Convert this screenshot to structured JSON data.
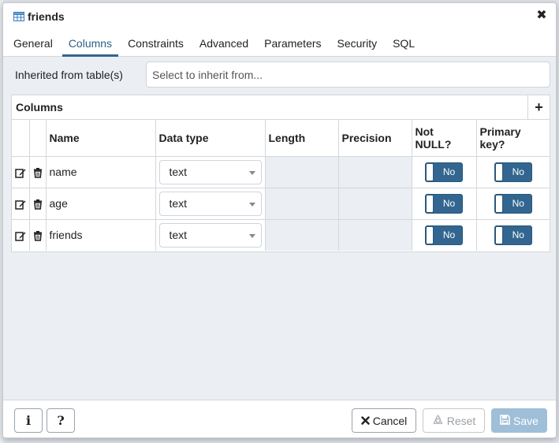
{
  "dialog": {
    "title": "friends",
    "close_glyph": "✖"
  },
  "tabs": [
    {
      "label": "General",
      "active": false
    },
    {
      "label": "Columns",
      "active": true
    },
    {
      "label": "Constraints",
      "active": false
    },
    {
      "label": "Advanced",
      "active": false
    },
    {
      "label": "Parameters",
      "active": false
    },
    {
      "label": "Security",
      "active": false
    },
    {
      "label": "SQL",
      "active": false
    }
  ],
  "inherit": {
    "label": "Inherited from table(s)",
    "placeholder": "Select to inherit from..."
  },
  "columns_panel": {
    "title": "Columns",
    "add_glyph": "+",
    "headers": [
      "Name",
      "Data type",
      "Length",
      "Precision",
      "Not NULL?",
      "Primary key?"
    ],
    "rows": [
      {
        "name": "name",
        "data_type": "text",
        "not_null": "No",
        "primary_key": "No"
      },
      {
        "name": "age",
        "data_type": "text",
        "not_null": "No",
        "primary_key": "No"
      },
      {
        "name": "friends",
        "data_type": "text",
        "not_null": "No",
        "primary_key": "No"
      }
    ]
  },
  "footer": {
    "info_glyph": "i",
    "help_glyph": "?",
    "cancel_label": "Cancel",
    "reset_label": "Reset",
    "save_label": "Save"
  },
  "colors": {
    "accent": "#326690",
    "save_disabled": "#9fbfd8"
  },
  "icons": {
    "title": "table-icon",
    "edit": "edit-icon",
    "delete": "trash-icon",
    "cancel": "close-icon",
    "reset": "recycle-icon",
    "save": "floppy-disk-icon"
  }
}
